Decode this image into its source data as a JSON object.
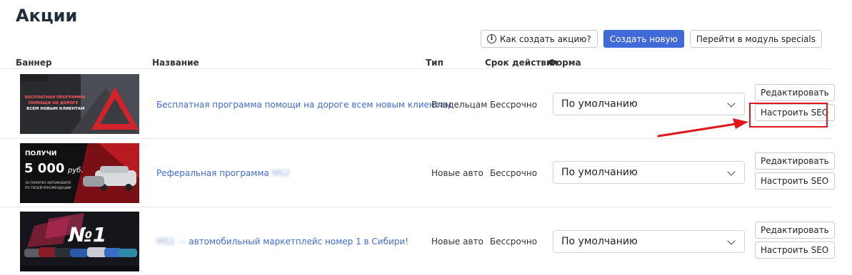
{
  "page": {
    "title": "Акции"
  },
  "toolbar": {
    "how_to_label": "Как создать акцию?",
    "create_label": "Создать новую",
    "goto_label": "Перейти в модуль specials"
  },
  "table": {
    "headers": {
      "banner": "Баннер",
      "name": "Название",
      "type": "Тип",
      "term": "Срок действия",
      "form": "Форма"
    },
    "rows": [
      {
        "name": "Бесплатная программа помощи на дороге всем новым клиентам",
        "name_blur": "",
        "name_rest": "",
        "type": "Владельцам",
        "term": "Бессрочно",
        "form": "По умолчанию",
        "edit": "Редактировать",
        "seo": "Настроить SEO",
        "banner_text": [
          "БЕСПЛАТНАЯ ПРОГРАММА",
          "ПОМОЩИ НА ДОРОГЕ",
          "ВСЕМ НОВЫМ КЛИЕНТАМ"
        ]
      },
      {
        "name": "Реферальная программа",
        "name_blur": "MS2",
        "name_rest": "",
        "type": "Новые авто",
        "term": "Бессрочно",
        "form": "По умолчанию",
        "edit": "Редактировать",
        "seo": "Настроить SEO",
        "banner_text": [
          "ПОЛУЧИ",
          "5 000",
          "руб.",
          "ЗА ПОКУПКУ АВТОМОБИЛЯ",
          "ПО ТВОЕЙ РЕКОМЕНДАЦИИ"
        ]
      },
      {
        "name": "",
        "name_blur": "MS2 —",
        "name_rest": "автомобильный маркетплейс номер 1 в Сибири!",
        "type": "Новые авто",
        "term": "Бессрочно",
        "form": "По умолчанию",
        "edit": "Редактировать",
        "seo": "Настроить SEO",
        "banner_text": [
          "№1"
        ]
      }
    ]
  },
  "colors": {
    "link": "#3f6ad8",
    "primary": "#3f6ad8",
    "highlight": "#e0161b"
  },
  "icons": {
    "info": "info-circle-icon",
    "dropdown": "chevron-down-icon",
    "annotation": "red-arrow-icon"
  }
}
